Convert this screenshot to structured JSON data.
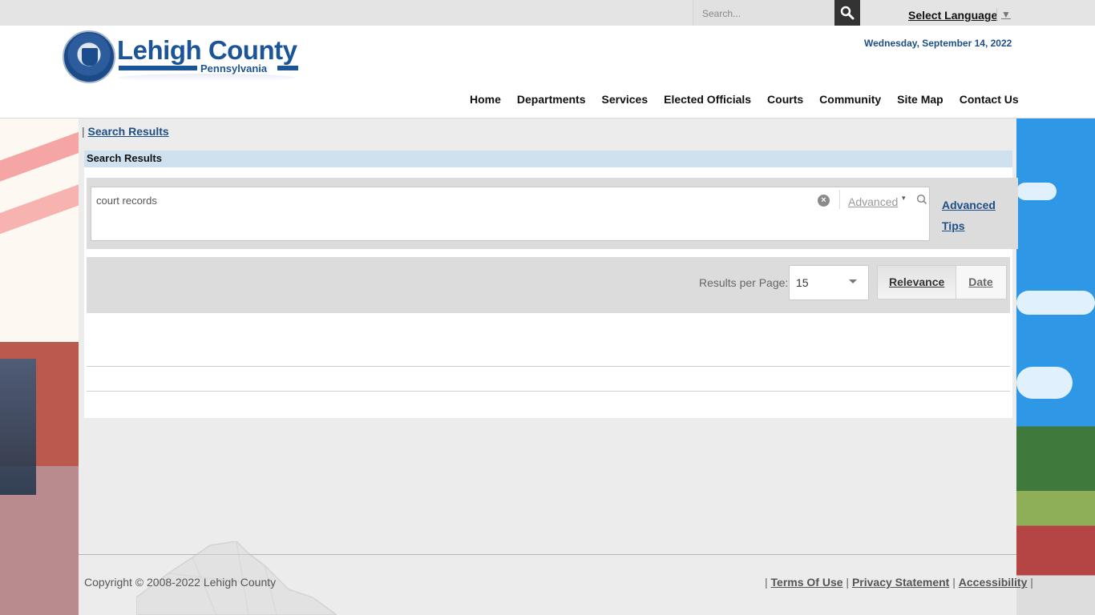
{
  "topbar": {
    "search_placeholder": "Search...",
    "search_icon": "magnifier-icon",
    "language_label": "Select Language",
    "language_arrow": "▼"
  },
  "header": {
    "logo_title": "Lehigh County",
    "logo_subtitle": "Pennsylvania",
    "date": "Wednesday, September 14, 2022",
    "nav": [
      "Home",
      "Departments",
      "Services",
      "Elected Officials",
      "Courts",
      "Community",
      "Site Map",
      "Contact Us"
    ]
  },
  "breadcrumb": {
    "separator": "|",
    "current": "Search Results"
  },
  "panel": {
    "title": "Search Results",
    "search": {
      "query": "court records",
      "clear_icon": "×",
      "advanced_dropdown_label": "Advanced",
      "caret": "▾"
    },
    "side_links": [
      "Advanced",
      "Tips"
    ],
    "results_per_page_label": "Results per Page:",
    "results_per_page_value": "15",
    "sort_options": [
      {
        "label": "Relevance",
        "active": true
      },
      {
        "label": "Date",
        "active": false
      }
    ]
  },
  "footer": {
    "copyright": "Copyright © 2008-2022 Lehigh County",
    "separator": "|",
    "links": [
      "Terms Of Use",
      "Privacy Statement",
      "Accessibility"
    ]
  },
  "colors": {
    "brand_blue": "#1c5597",
    "link_blue": "#1d4f86",
    "panel_header": "#cfe1ef",
    "topbar_gray": "#e4e4e4"
  }
}
